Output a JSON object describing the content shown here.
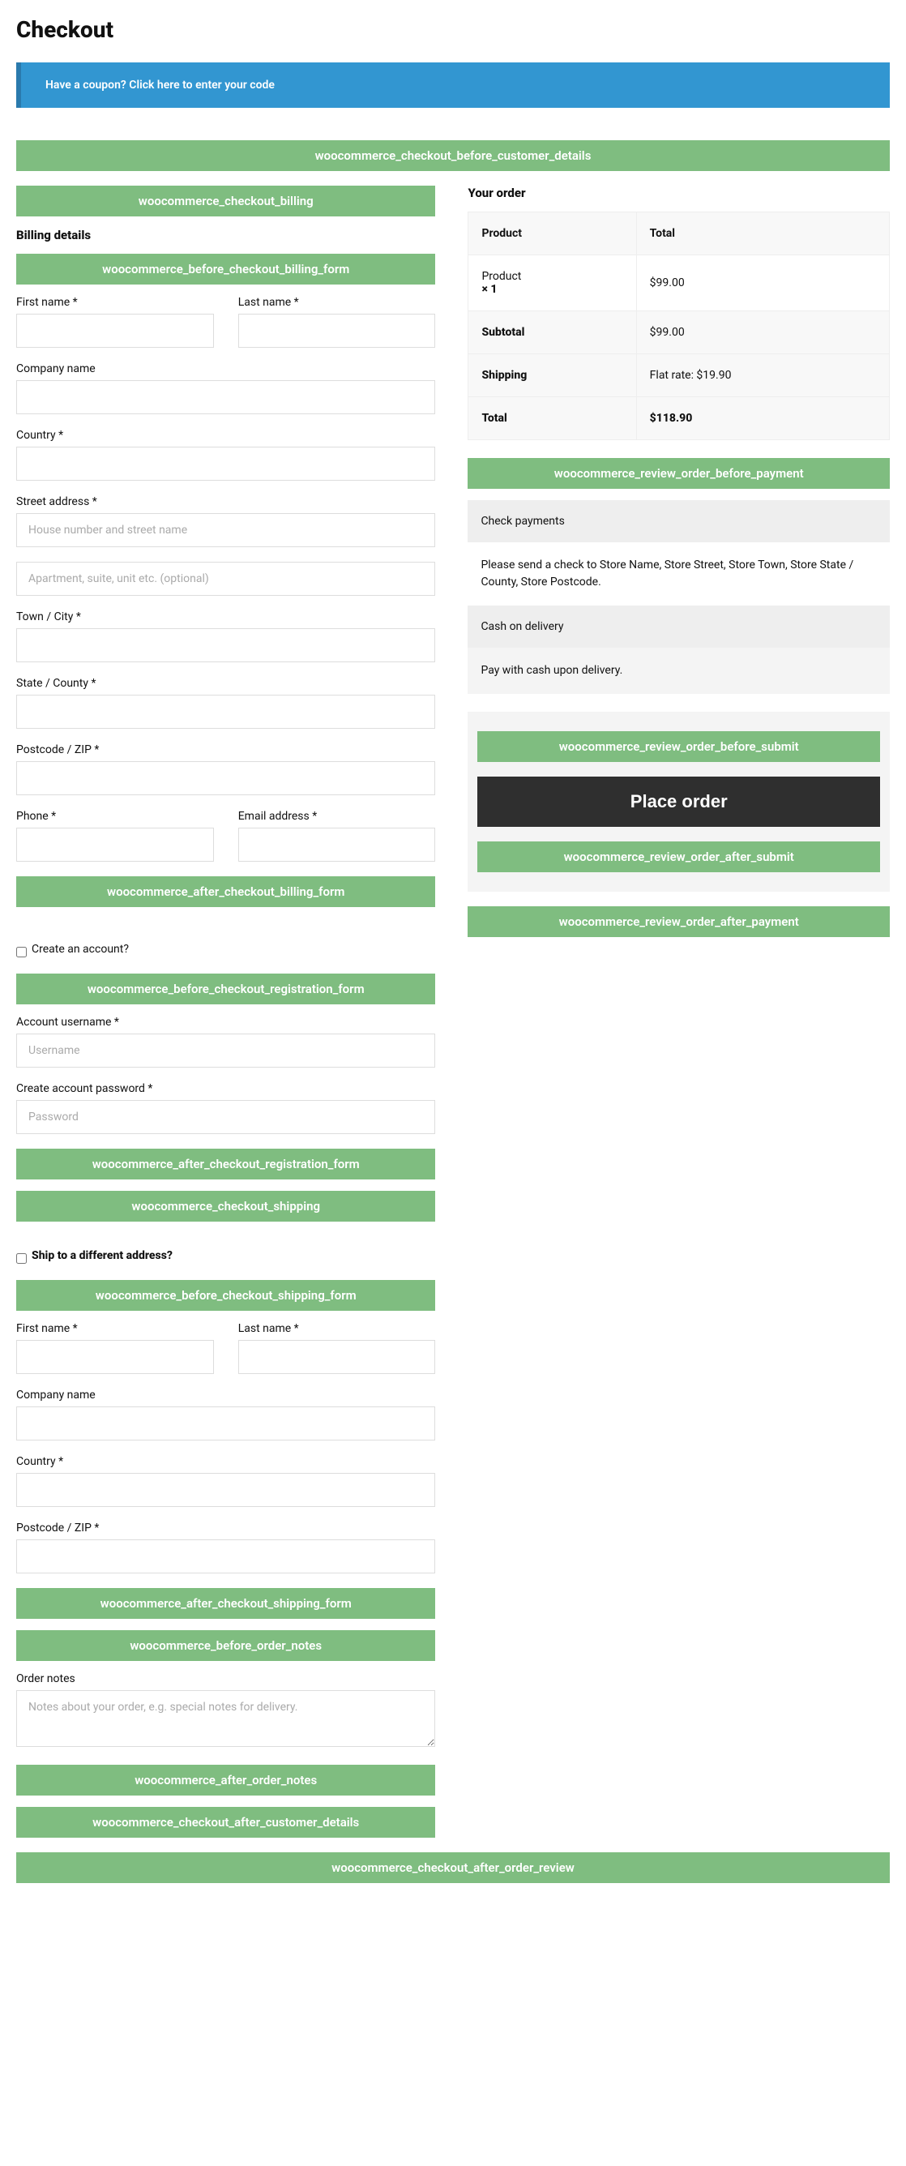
{
  "page_title": "Checkout",
  "coupon_notice": "Have a coupon? Click here to enter your code",
  "hooks": {
    "before_customer_details": "woocommerce_checkout_before_customer_details",
    "checkout_billing": "woocommerce_checkout_billing",
    "before_billing_form": "woocommerce_before_checkout_billing_form",
    "after_billing_form": "woocommerce_after_checkout_billing_form",
    "before_registration_form": "woocommerce_before_checkout_registration_form",
    "after_registration_form": "woocommerce_after_checkout_registration_form",
    "checkout_shipping": "woocommerce_checkout_shipping",
    "before_shipping_form": "woocommerce_before_checkout_shipping_form",
    "after_shipping_form": "woocommerce_after_checkout_shipping_form",
    "before_order_notes": "woocommerce_before_order_notes",
    "after_order_notes": "woocommerce_after_order_notes",
    "after_customer_details": "woocommerce_checkout_after_customer_details",
    "after_order_review": "woocommerce_checkout_after_order_review",
    "review_before_payment": "woocommerce_review_order_before_payment",
    "review_before_submit": "woocommerce_review_order_before_submit",
    "review_after_submit": "woocommerce_review_order_after_submit",
    "review_after_payment": "woocommerce_review_order_after_payment"
  },
  "billing": {
    "heading": "Billing details",
    "first_name": "First name *",
    "last_name": "Last name *",
    "company": "Company name",
    "country": "Country *",
    "street": "Street address *",
    "street_ph1": "House number and street name",
    "street_ph2": "Apartment, suite, unit etc. (optional)",
    "town": "Town / City *",
    "state": "State / County *",
    "postcode": "Postcode / ZIP *",
    "phone": "Phone *",
    "email": "Email address *"
  },
  "account": {
    "create_label": "Create an account?",
    "username_label": "Account username *",
    "username_ph": "Username",
    "password_label": "Create account password *",
    "password_ph": "Password"
  },
  "shipping": {
    "toggle_label": "Ship to a different address?",
    "first_name": "First name *",
    "last_name": "Last name *",
    "company": "Company name",
    "country": "Country *",
    "postcode": "Postcode / ZIP *"
  },
  "notes": {
    "label": "Order notes",
    "ph": "Notes about your order, e.g. special notes for delivery."
  },
  "order": {
    "heading": "Your order",
    "th_product": "Product",
    "th_total": "Total",
    "item_name": "Product",
    "item_qty": "× 1",
    "item_price": "$99.00",
    "subtotal_label": "Subtotal",
    "subtotal_value": "$99.00",
    "shipping_label": "Shipping",
    "shipping_value": "Flat rate: $19.90",
    "total_label": "Total",
    "total_value": "$118.90"
  },
  "payment": {
    "check_title": "Check payments",
    "check_desc": "Please send a check to Store Name, Store Street, Store Town, Store State / County, Store Postcode.",
    "cod_title": "Cash on delivery",
    "cod_desc": "Pay with cash upon delivery."
  },
  "place_order": "Place order"
}
